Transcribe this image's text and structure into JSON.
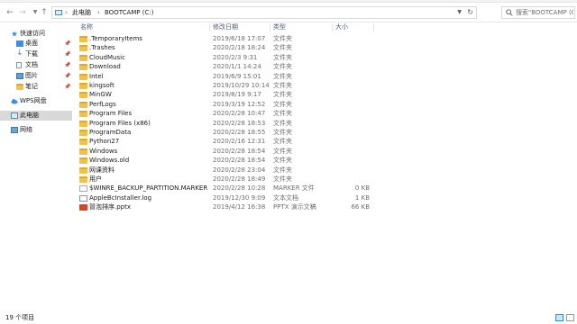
{
  "address": {
    "segments": [
      "此电脑",
      "BOOTCAMP (C:)"
    ]
  },
  "search": {
    "placeholder": "搜索\"BOOTCAMP (C:)\""
  },
  "sidebar": {
    "items": [
      {
        "label": "快速访问",
        "icon": "star-icon",
        "pinned": false
      },
      {
        "label": "桌面",
        "icon": "desktop-icon",
        "pinned": true
      },
      {
        "label": "下载",
        "icon": "download-icon",
        "pinned": true
      },
      {
        "label": "文档",
        "icon": "document-icon",
        "pinned": true
      },
      {
        "label": "图片",
        "icon": "picture-icon",
        "pinned": true
      },
      {
        "label": "笔记",
        "icon": "folder-icon",
        "pinned": true
      },
      {
        "label": "WPS网盘",
        "icon": "cloud-icon",
        "pinned": false
      },
      {
        "label": "此电脑",
        "icon": "computer-icon",
        "pinned": false,
        "selected": true
      },
      {
        "label": "网络",
        "icon": "network-icon",
        "pinned": false
      }
    ]
  },
  "columns": {
    "name": "名称",
    "date": "修改日期",
    "type": "类型",
    "size": "大小"
  },
  "files": [
    {
      "name": ".TemporaryItems",
      "date": "2019/6/18 17:07",
      "type": "文件夹",
      "size": "",
      "kind": "folder"
    },
    {
      "name": ".Trashes",
      "date": "2020/2/18 18:24",
      "type": "文件夹",
      "size": "",
      "kind": "folder"
    },
    {
      "name": "CloudMusic",
      "date": "2020/2/3 9:31",
      "type": "文件夹",
      "size": "",
      "kind": "folder"
    },
    {
      "name": "Download",
      "date": "2020/1/1 14:24",
      "type": "文件夹",
      "size": "",
      "kind": "folder"
    },
    {
      "name": "Intel",
      "date": "2019/6/9 15:01",
      "type": "文件夹",
      "size": "",
      "kind": "folder"
    },
    {
      "name": "kingsoft",
      "date": "2019/10/29 10:14",
      "type": "文件夹",
      "size": "",
      "kind": "folder"
    },
    {
      "name": "MinGW",
      "date": "2019/8/19 9:17",
      "type": "文件夹",
      "size": "",
      "kind": "folder"
    },
    {
      "name": "PerfLogs",
      "date": "2019/3/19 12:52",
      "type": "文件夹",
      "size": "",
      "kind": "folder"
    },
    {
      "name": "Program Files",
      "date": "2020/2/28 10:47",
      "type": "文件夹",
      "size": "",
      "kind": "folder"
    },
    {
      "name": "Program Files (x86)",
      "date": "2020/2/28 18:53",
      "type": "文件夹",
      "size": "",
      "kind": "folder"
    },
    {
      "name": "ProgramData",
      "date": "2020/2/28 18:55",
      "type": "文件夹",
      "size": "",
      "kind": "folder"
    },
    {
      "name": "Python27",
      "date": "2020/2/16 12:31",
      "type": "文件夹",
      "size": "",
      "kind": "folder"
    },
    {
      "name": "Windows",
      "date": "2020/2/28 18:54",
      "type": "文件夹",
      "size": "",
      "kind": "folder"
    },
    {
      "name": "Windows.old",
      "date": "2020/2/28 18:54",
      "type": "文件夹",
      "size": "",
      "kind": "folder"
    },
    {
      "name": "网课资料",
      "date": "2020/2/28 23:04",
      "type": "文件夹",
      "size": "",
      "kind": "folder"
    },
    {
      "name": "用户",
      "date": "2020/2/28 18:49",
      "type": "文件夹",
      "size": "",
      "kind": "folder"
    },
    {
      "name": "$WINRE_BACKUP_PARTITION.MARKER",
      "date": "2020/2/28 10:28",
      "type": "MARKER 文件",
      "size": "0 KB",
      "kind": "file"
    },
    {
      "name": "AppleBcInstaller.log",
      "date": "2019/12/30 9:09",
      "type": "文本文档",
      "size": "1 KB",
      "kind": "log"
    },
    {
      "name": "冒泡排序.pptx",
      "date": "2019/4/12 16:38",
      "type": "PPTX 演示文稿",
      "size": "66 KB",
      "kind": "pptx"
    }
  ],
  "status": {
    "item_count": "19 个项目"
  }
}
